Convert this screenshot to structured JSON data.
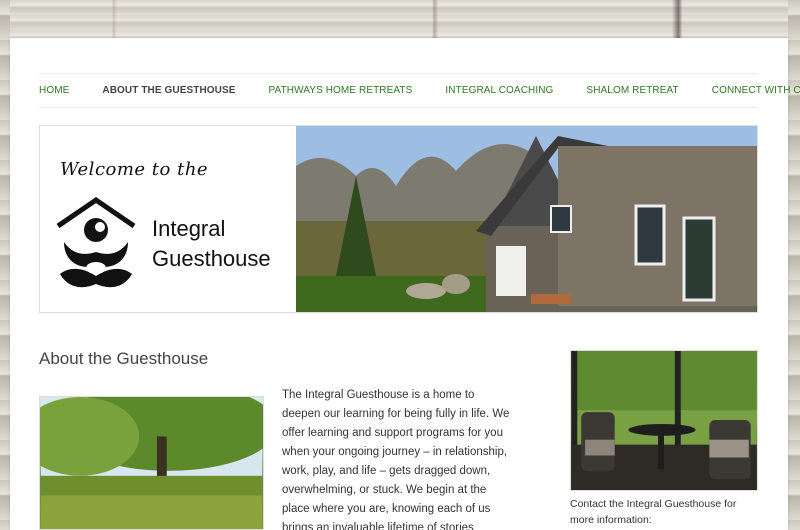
{
  "nav": {
    "items": [
      {
        "label": "HOME",
        "active": false
      },
      {
        "label": "ABOUT THE GUESTHOUSE",
        "active": true
      },
      {
        "label": "PATHWAYS HOME RETREATS",
        "active": false
      },
      {
        "label": "INTEGRAL COACHING",
        "active": false
      },
      {
        "label": "SHALOM RETREAT",
        "active": false
      },
      {
        "label": "CONNECT WITH CHRIS",
        "active": false
      }
    ]
  },
  "banner": {
    "welcome": "Welcome to the",
    "brand_line1": "Integral",
    "brand_line2": "Guesthouse"
  },
  "main": {
    "title": "About the Guesthouse",
    "intro": "The Integral Guesthouse is a home to deepen our learning for being fully in life. We offer learning and support programs for you when your ongoing journey – in relationship, work, play, and life – gets dragged down, overwhelming, or stuck. We begin at the place where you are, knowing each of us brings an invaluable lifetime of stories"
  },
  "sidebar": {
    "contact": "Contact the Integral Guesthouse for more information:"
  },
  "colors": {
    "nav_link": "#2b7a1f",
    "nav_active": "#444444",
    "text": "#333333"
  }
}
